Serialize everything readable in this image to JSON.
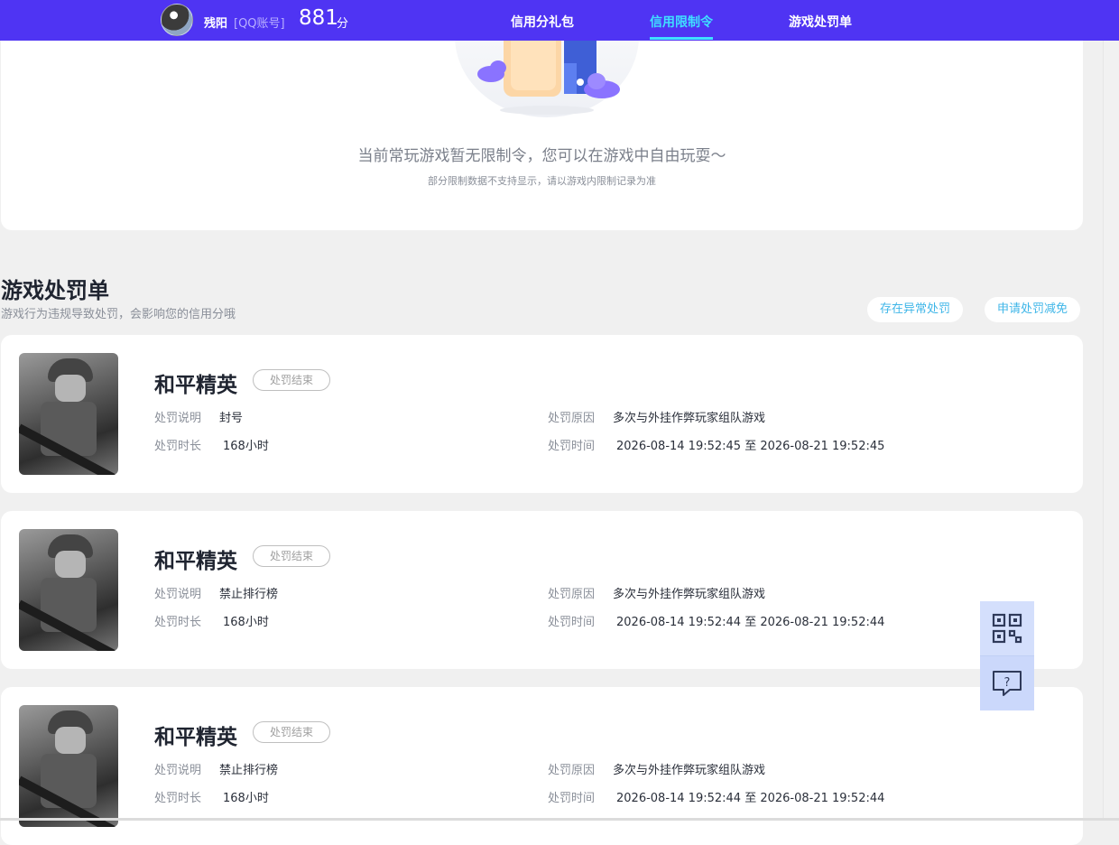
{
  "header": {
    "username": "残阳",
    "account_type": "[QQ账号]",
    "score": "881",
    "score_unit": "分",
    "tabs": [
      {
        "label": "信用分礼包",
        "active": false
      },
      {
        "label": "信用限制令",
        "active": true
      },
      {
        "label": "游戏处罚单",
        "active": false
      }
    ],
    "accent_color": "#4f34f3",
    "active_tab_color": "#3fe0ff"
  },
  "restriction": {
    "message": "当前常玩游戏暂无限制令，您可以在游戏中自由玩耍～",
    "note": "部分限制数据不支持显示，请以游戏内限制记录为准"
  },
  "penalty_section": {
    "title": "游戏处罚单",
    "subtitle": "游戏行为违规导致处罚，会影响您的信用分哦",
    "buttons": {
      "dispute": "存在异常处罚",
      "appeal": "申请处罚减免"
    },
    "labels": {
      "desc": "处罚说明",
      "duration": "处罚时长",
      "reason": "处罚原因",
      "time": "处罚时间"
    },
    "items": [
      {
        "game": "和平精英",
        "status": "处罚结束",
        "desc": "封号",
        "duration": "168小时",
        "reason": "多次与外挂作弊玩家组队游戏",
        "time": "2026-08-14 19:52:45 至 2026-08-21 19:52:45"
      },
      {
        "game": "和平精英",
        "status": "处罚结束",
        "desc": "禁止排行榜",
        "duration": "168小时",
        "reason": "多次与外挂作弊玩家组队游戏",
        "time": "2026-08-14 19:52:44 至 2026-08-21 19:52:44"
      },
      {
        "game": "和平精英",
        "status": "处罚结束",
        "desc": "禁止排行榜",
        "duration": "168小时",
        "reason": "多次与外挂作弊玩家组队游戏",
        "time": "2026-08-14 19:52:44 至 2026-08-21 19:52:44"
      }
    ]
  },
  "side_tools": {
    "icons": [
      "qr-code-icon",
      "help-chat-icon"
    ]
  }
}
